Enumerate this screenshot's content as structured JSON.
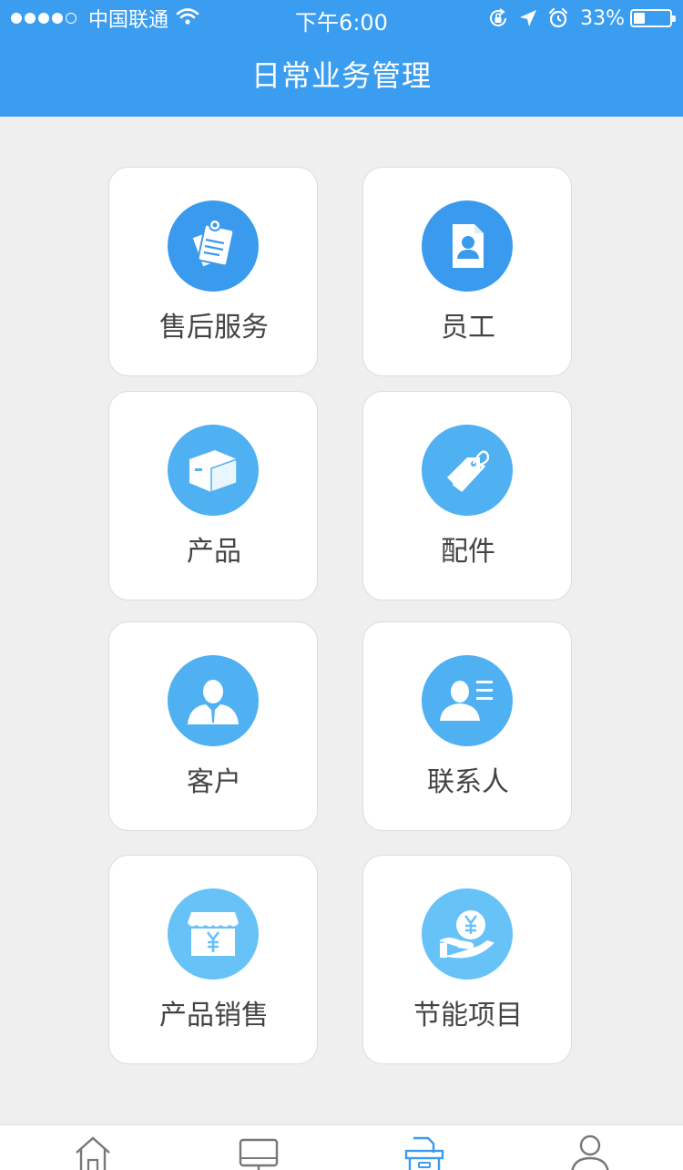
{
  "status_bar": {
    "carrier": "中国联通",
    "time": "下午6:00",
    "battery": "33%"
  },
  "header": {
    "title": "日常业务管理"
  },
  "menu": [
    {
      "label": "售后服务",
      "icon": "clipboard-notes-icon",
      "color": "#3a9bee"
    },
    {
      "label": "员工",
      "icon": "employee-badge-icon",
      "color": "#3a9bee"
    },
    {
      "label": "产品",
      "icon": "product-box-icon",
      "color": "#4fb0f2"
    },
    {
      "label": "配件",
      "icon": "accessory-tag-icon",
      "color": "#4fb0f2"
    },
    {
      "label": "客户",
      "icon": "customer-person-icon",
      "color": "#4fb0f2"
    },
    {
      "label": "联系人",
      "icon": "contact-card-icon",
      "color": "#4fb0f2"
    },
    {
      "label": "产品销售",
      "icon": "shop-yen-icon",
      "color": "#66c2f7"
    },
    {
      "label": "节能项目",
      "icon": "hand-yen-coin-icon",
      "color": "#66c2f7"
    }
  ],
  "tab_bar": {
    "items": [
      {
        "icon": "home-icon",
        "active": false
      },
      {
        "icon": "monitor-icon",
        "active": false
      },
      {
        "icon": "files-icon",
        "active": true
      },
      {
        "icon": "profile-icon",
        "active": false
      }
    ],
    "active_color": "#3a9bee",
    "inactive_color": "#777777"
  }
}
